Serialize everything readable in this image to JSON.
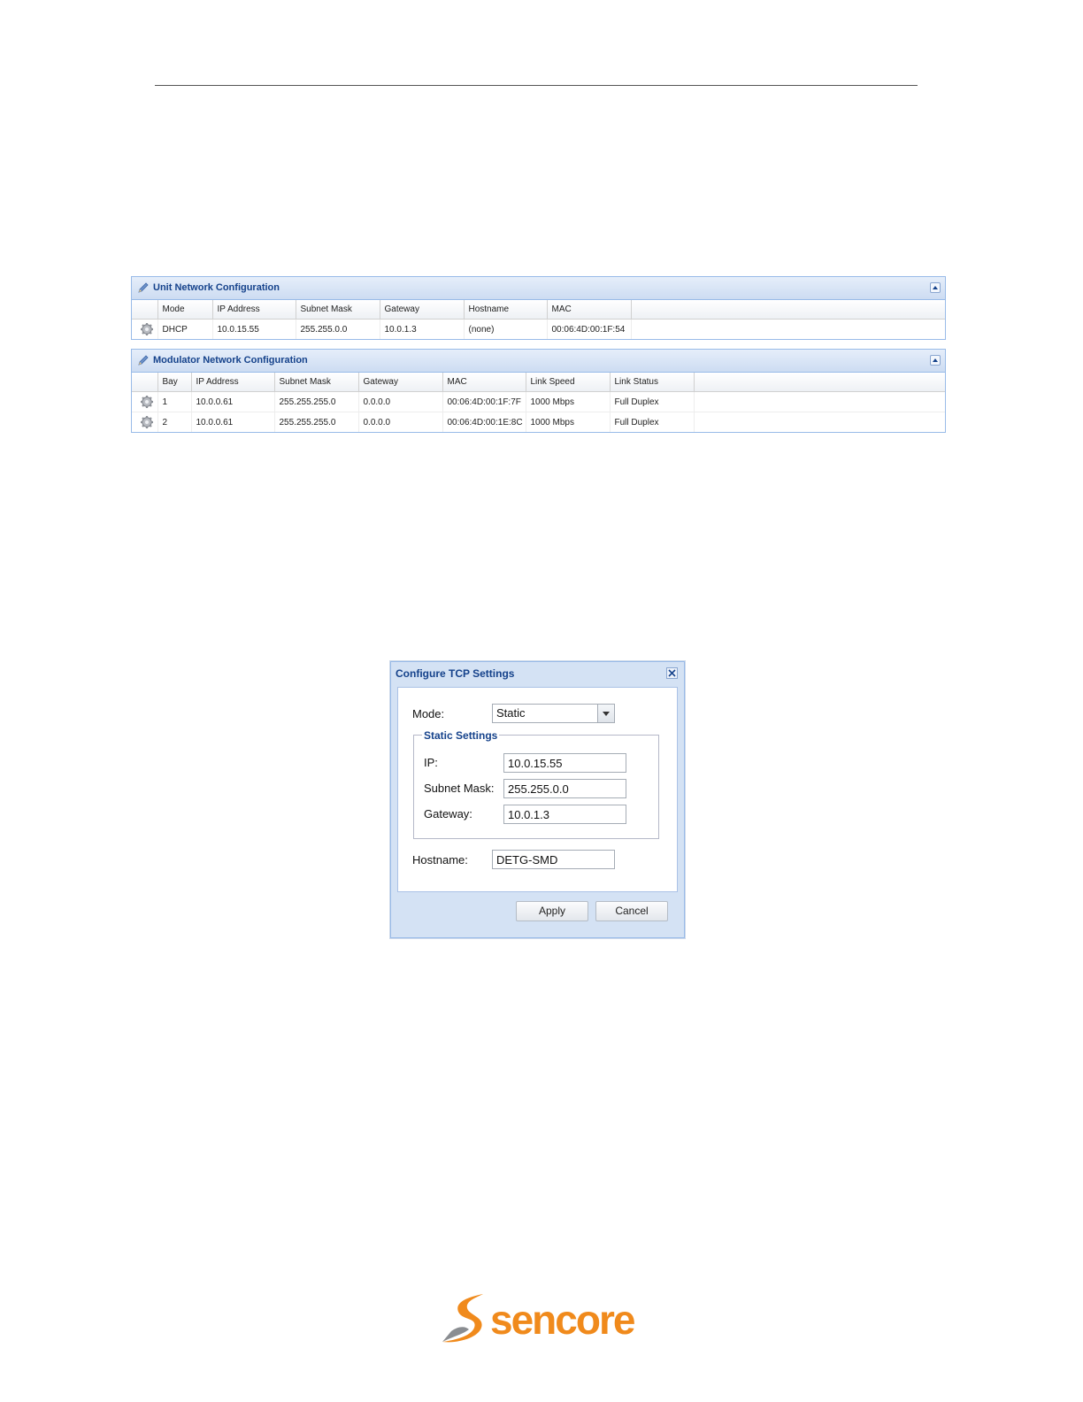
{
  "unit_panel": {
    "title": "Unit Network Configuration",
    "columns": [
      "Mode",
      "IP Address",
      "Subnet Mask",
      "Gateway",
      "Hostname",
      "MAC"
    ],
    "rows": [
      [
        "DHCP",
        "10.0.15.55",
        "255.255.0.0",
        "10.0.1.3",
        "(none)",
        "00:06:4D:00:1F:54"
      ]
    ]
  },
  "modulator_panel": {
    "title": "Modulator Network Configuration",
    "columns": [
      "Bay",
      "IP Address",
      "Subnet Mask",
      "Gateway",
      "MAC",
      "Link Speed",
      "Link Status"
    ],
    "rows": [
      [
        "1",
        "10.0.0.61",
        "255.255.255.0",
        "0.0.0.0",
        "00:06:4D:00:1F:7F",
        "1000 Mbps",
        "Full Duplex"
      ],
      [
        "2",
        "10.0.0.61",
        "255.255.255.0",
        "0.0.0.0",
        "00:06:4D:00:1E:8C",
        "1000 Mbps",
        "Full Duplex"
      ]
    ]
  },
  "dialog": {
    "title": "Configure TCP Settings",
    "mode_label": "Mode:",
    "mode_value": "Static",
    "static_legend": "Static Settings",
    "ip_label": "IP:",
    "ip_value": "10.0.15.55",
    "subnet_label": "Subnet Mask:",
    "subnet_value": "255.255.0.0",
    "gateway_label": "Gateway:",
    "gateway_value": "10.0.1.3",
    "hostname_label": "Hostname:",
    "hostname_value": "DETG-SMD",
    "apply_label": "Apply",
    "cancel_label": "Cancel"
  },
  "footer": {
    "logo_text": "sencore"
  },
  "colors": {
    "header_blue": "#15428b",
    "brand_orange": "#f08a1c",
    "brand_gray": "#8a8d91"
  }
}
